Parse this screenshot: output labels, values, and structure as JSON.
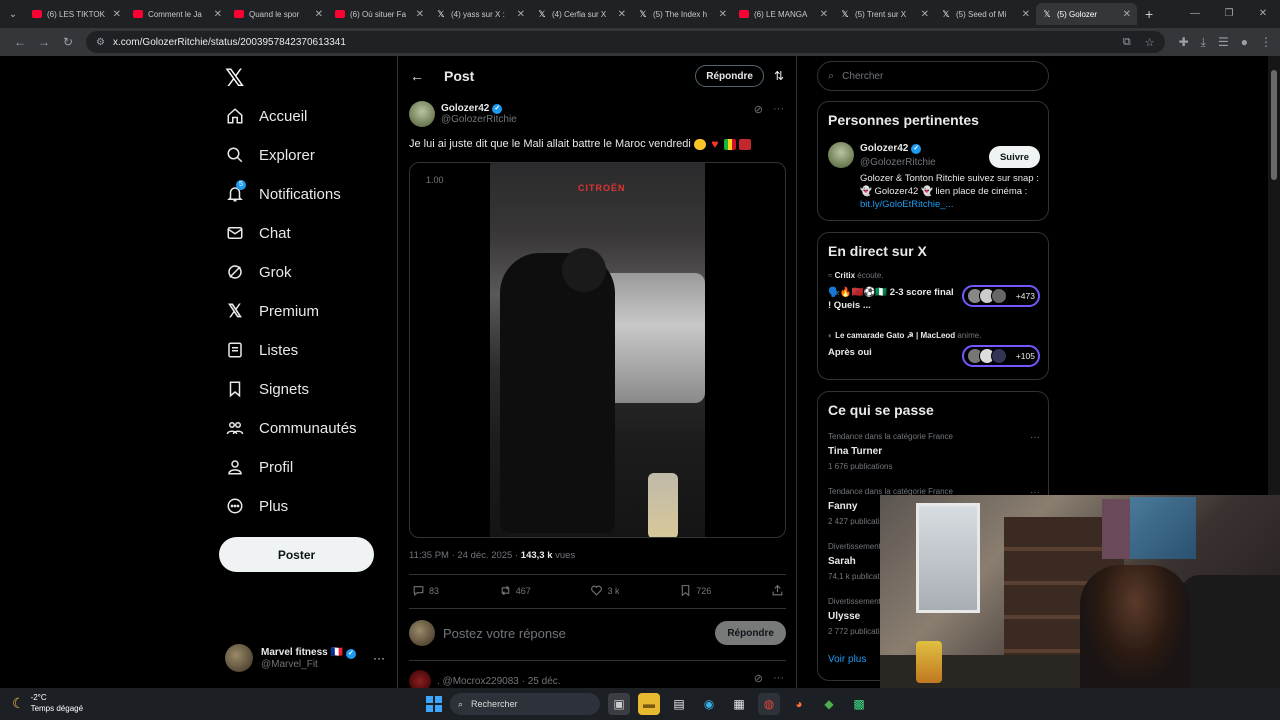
{
  "browser": {
    "tabs": [
      {
        "title": "(6) LES TIKTOK",
        "icon": "youtube-icon"
      },
      {
        "title": "Comment le Ja",
        "icon": "youtube-icon"
      },
      {
        "title": "Quand le spor",
        "icon": "youtube-icon"
      },
      {
        "title": "(6) Où situer Fa",
        "icon": "youtube-icon"
      },
      {
        "title": "(4) yass sur X :",
        "icon": "x-icon"
      },
      {
        "title": "(4) Cerfia sur X",
        "icon": "x-icon"
      },
      {
        "title": "(5) The Index h",
        "icon": "x-icon"
      },
      {
        "title": "(6) LE MANGA",
        "icon": "youtube-icon"
      },
      {
        "title": "(5) Trent sur X",
        "icon": "x-icon"
      },
      {
        "title": "(5) Seed of Mi",
        "icon": "x-icon"
      },
      {
        "title": "(5) Golozer",
        "icon": "x-icon",
        "active": true
      }
    ],
    "url": "x.com/GolozerRitchie/status/2003957842370613341"
  },
  "nav": {
    "items": [
      "Accueil",
      "Explorer",
      "Notifications",
      "Chat",
      "Grok",
      "Premium",
      "Listes",
      "Signets",
      "Communautés",
      "Profil",
      "Plus"
    ],
    "notif_badge": "5",
    "post_button": "Poster",
    "me_name": "Marvel fitness 🇫🇷",
    "me_handle": "@Marvel_Fit"
  },
  "post": {
    "header_title": "Post",
    "reply_button": "Répondre",
    "author_name": "Golozer42",
    "author_handle": "@GolozerRitchie",
    "text": "Je lui ai juste dit que le Mali allait battre le Maroc vendredi",
    "video_speed": "1.00",
    "video_sign": "CITROËN",
    "time": "11:35 PM · 24 déc. 2025 · ",
    "views_count": "143,3 k",
    "views_label": " vues",
    "replies": "83",
    "reposts": "467",
    "likes": "3 k",
    "bookmarks": "726",
    "compose_placeholder": "Postez votre réponse",
    "compose_button": "Répondre",
    "next_reply": ". @Mocrox229083 · 25 déc."
  },
  "sidebar": {
    "search_placeholder": "Chercher",
    "relevant_title": "Personnes pertinentes",
    "rel_name": "Golozer42",
    "rel_handle": "@GolozerRitchie",
    "follow": "Suivre",
    "rel_bio": "Golozer & Tonton Ritchie suivez sur snap : 👻 Golozer42 👻 lien place de cinéma : ",
    "rel_link": "bit.ly/GoloEtRitchie_...",
    "live_title": "En direct sur X",
    "live": [
      {
        "host": "Critix",
        "action": " écoute.",
        "title": "🗣️🔥🇲🇦⚽🇳🇬 2-3 score final ! Queis ...",
        "count": "+473"
      },
      {
        "host": "Le camarade Gato ☭ | MacLeod",
        "action": " anime.",
        "title": "Après oui",
        "count": "+105"
      }
    ],
    "trends_title": "Ce qui se passe",
    "trends": [
      {
        "category": "Tendance dans la catégorie France",
        "name": "Tina Turner",
        "count": "1 676 publications"
      },
      {
        "category": "Tendance dans la catégorie France",
        "name": "Fanny",
        "count": "2 427 publications"
      },
      {
        "category": "Divertissement",
        "name": "Sarah",
        "count": "74,1 k publications"
      },
      {
        "category": "Divertissement",
        "name": "Ulysse",
        "count": "2 772 publications"
      }
    ],
    "see_more": "Voir plus"
  },
  "taskbar": {
    "temp": "-2°C",
    "weather": "Temps dégagé",
    "search": "Rechercher"
  },
  "colors": {
    "accent": "#1d9bf0",
    "live_ring": "#7856ff",
    "background": "#000000"
  }
}
